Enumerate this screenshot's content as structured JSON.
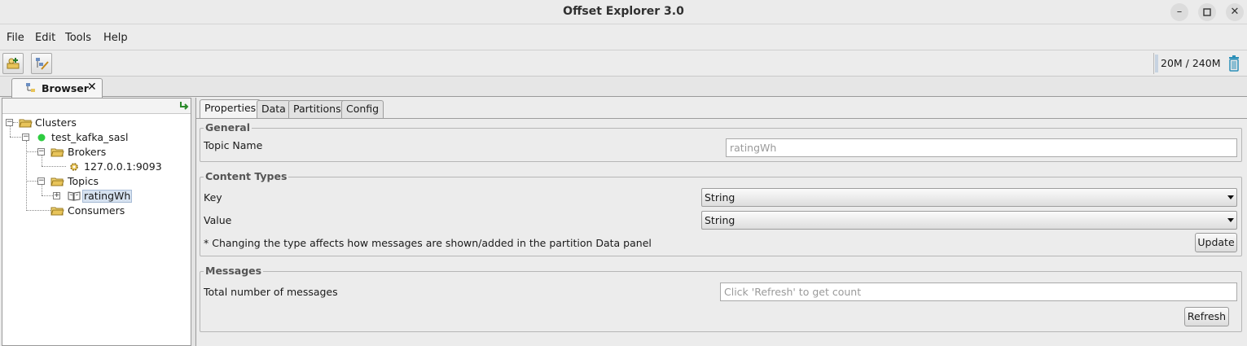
{
  "window": {
    "title": "Offset Explorer  3.0"
  },
  "menu": {
    "file": "File",
    "edit": "Edit",
    "tools": "Tools",
    "help": "Help"
  },
  "toolbar": {
    "memory": "20M / 240M"
  },
  "tabs": {
    "browser": "Browser"
  },
  "tree": {
    "clusters": "Clusters",
    "cluster": "test_kafka_sasl",
    "brokers": "Brokers",
    "broker": "127.0.0.1:9093",
    "topics": "Topics",
    "topic": "ratingWh",
    "consumers": "Consumers"
  },
  "subtabs": [
    "Properties",
    "Data",
    "Partitions",
    "Config"
  ],
  "general": {
    "title": "General",
    "topic_name_label": "Topic Name",
    "topic_name_value": "ratingWh"
  },
  "content_types": {
    "title": "Content Types",
    "key_label": "Key",
    "key_value": "String",
    "value_label": "Value",
    "value_value": "String",
    "note": "* Changing the type affects how messages are shown/added in the partition Data panel",
    "update_button": "Update"
  },
  "messages": {
    "title": "Messages",
    "total_label": "Total number of messages",
    "total_placeholder": "Click 'Refresh' to get count",
    "refresh_button": "Refresh"
  },
  "colors": {
    "status_green": "#2ecc40",
    "folder": "#e8c45a",
    "trash": "#2b8fb8"
  }
}
